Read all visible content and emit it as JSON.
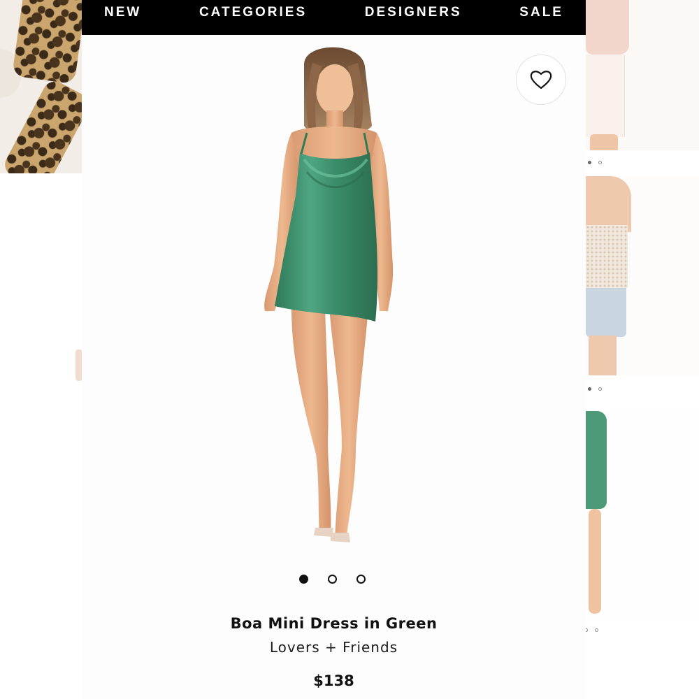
{
  "nav": {
    "items": [
      "NEW",
      "CATEGORIES",
      "DESIGNERS",
      "SALE"
    ]
  },
  "product": {
    "name": "Boa Mini Dress in Green",
    "brand": "Lovers + Friends",
    "price": "$138",
    "image_count": 3,
    "active_image": 1
  },
  "icons": {
    "wishlist": "heart-outline-icon"
  },
  "colors": {
    "nav_background": "#000000",
    "nav_text": "#ffffff",
    "dress_green": "#3f8f6c"
  }
}
